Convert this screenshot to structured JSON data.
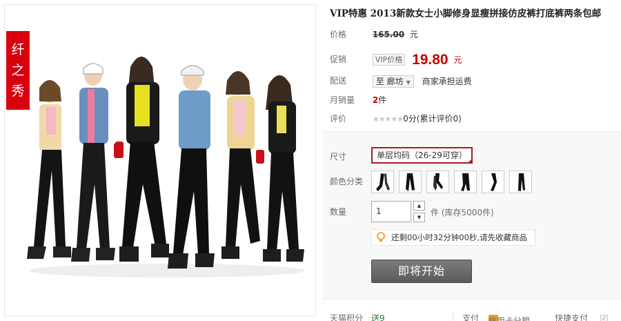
{
  "brand": {
    "chars": [
      "纤",
      "之",
      "秀"
    ]
  },
  "product": {
    "title": "VIP特惠 2013新款女士小脚修身显瘦拼接仿皮裤打底裤两条包邮"
  },
  "price": {
    "label": "价格",
    "value": "165.00",
    "currency": "元"
  },
  "promo": {
    "label": "促销",
    "badge": "VIP价格",
    "value": "19.80",
    "currency": "元"
  },
  "shipping": {
    "label": "配送",
    "destination": "至 廊坊",
    "note": "商家承担运费"
  },
  "sales": {
    "label": "月销量",
    "value": "2",
    "unit": "件"
  },
  "rating": {
    "label": "评价",
    "stars": "★★★★★",
    "text": "0分(累计评价0)"
  },
  "size": {
    "label": "尺寸",
    "selected": "单层均码（26-29可穿）"
  },
  "color": {
    "label": "颜色分类",
    "swatch_count": 6
  },
  "quantity": {
    "label": "数量",
    "value": "1",
    "stock_note": "件 (库存5000件)"
  },
  "reminder": {
    "text": "还剩00小时32分钟00秒,请先收藏商品"
  },
  "buy_button": {
    "label": "即将开始"
  },
  "footer": {
    "points_label": "天猫积分",
    "points_value": "送9",
    "pay_label": "支付",
    "card_label": "信用卡分期",
    "quick_pay": "快捷支付"
  },
  "colors": {
    "price_red": "#c40000",
    "brand_red": "#d8000f",
    "selected_border": "#b1191a",
    "button_gray": "#6a6a6a"
  }
}
